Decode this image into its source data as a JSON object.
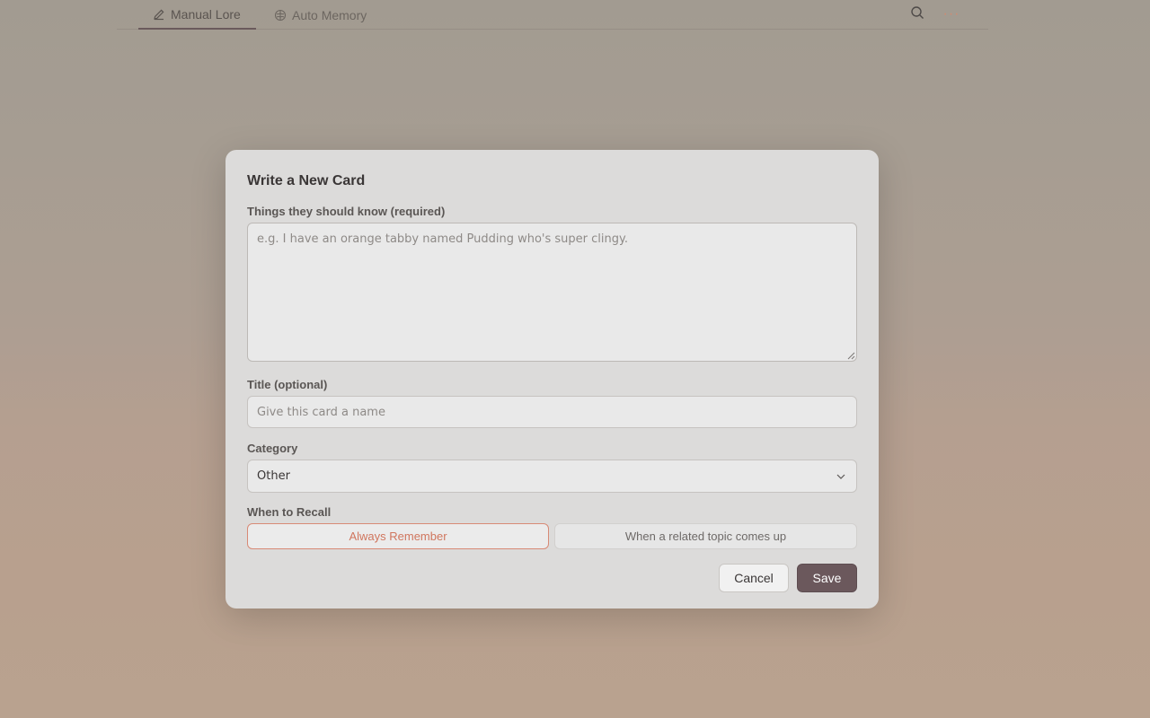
{
  "tabs": [
    {
      "label": "Manual Lore",
      "icon": "pencil-icon",
      "active": true
    },
    {
      "label": "Auto Memory",
      "icon": "brain-icon",
      "active": false
    }
  ],
  "toolbar": {
    "search_icon": "search-icon",
    "more_icon": "more-dots-icon",
    "more_glyph": "···"
  },
  "modal": {
    "title": "Write a New Card",
    "content_label": "Things they should know (required)",
    "content_value": "",
    "content_placeholder": "e.g. I have an orange tabby named Pudding who's super clingy.",
    "title_label": "Title (optional)",
    "title_value": "",
    "title_placeholder": "Give this card a name",
    "category_label": "Category",
    "category_value": "Other",
    "recall_label": "When to Recall",
    "recall_options": [
      {
        "label": "Always Remember",
        "selected": true
      },
      {
        "label": "When a related topic comes up",
        "selected": false
      }
    ],
    "cancel_label": "Cancel",
    "save_label": "Save"
  },
  "colors": {
    "accent": "#d0765e",
    "primary_button": "#6b585c",
    "modal_bg": "#dcdbda"
  }
}
